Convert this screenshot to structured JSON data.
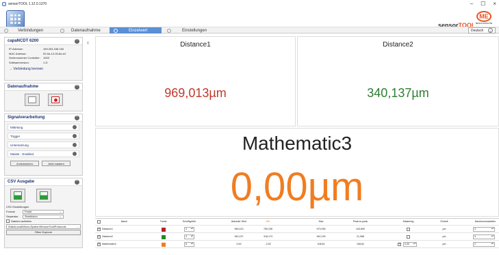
{
  "window": {
    "title": "sensorTOOL 1.12.0.1370",
    "min": "–",
    "max": "☐",
    "close": "×"
  },
  "brand": {
    "prefix": "sensor",
    "accent": "TOOL",
    "me_text": "ME",
    "me_sub": "MICRO-EPSILON"
  },
  "nav": {
    "tabs": [
      "Verbindungen",
      "Datenaufnahme",
      "Einzelwert",
      "Einstellungen"
    ],
    "active_index": 2,
    "language": "Deutsch"
  },
  "sidebar": {
    "device": {
      "title": "capaNCDT 6200",
      "rows": [
        {
          "k": "IP-Adresse:",
          "v": "169.254.168.150"
        },
        {
          "k": "MAC Adresse:",
          "v": "00-0a-12-00-8e-e2"
        },
        {
          "k": "Seriennummer Controller:",
          "v": "1003"
        },
        {
          "k": "Softwareversion:",
          "v": "1.2i"
        }
      ],
      "disconnect": "Verbindung trennen"
    },
    "datenaufnahme": {
      "title": "Datenaufnahme"
    },
    "signal": {
      "title": "Signalverarbeitung",
      "items": [
        "Mittelung",
        "Trigger",
        "Untersetzung",
        "Master : Enabled"
      ],
      "buttons": [
        "Zurücksetzen",
        "Jetzt mastern"
      ]
    },
    "csv": {
      "title": "CSV Ausgabe",
      "settings_label": "CSV Einstellungen",
      "format_label": "Format",
      "format_value": "Punkt",
      "separator_label": "Separator",
      "separator_value": "Semikolon",
      "split_label": "Dateien aufteilen",
      "path": "\\Data\\Local\\Micro-Epsilon\\SensorTool\\Protocols",
      "browse": "...",
      "open": "Öffne Explorer"
    }
  },
  "displays": [
    {
      "title": "Distance1",
      "value": "969,013µm",
      "color": "#c0392b"
    },
    {
      "title": "Distance2",
      "value": "340,137µm",
      "color": "#2e7d32"
    },
    {
      "title": "Mathematic3",
      "value": "0,00µm",
      "color": "#f07d22"
    }
  ],
  "table": {
    "headers": [
      "Name",
      "Farbe",
      "Schriftgröße",
      "Aktueller Wert",
      "Min",
      "Max",
      "Peak-to-peak",
      "Mastering",
      "Einheit",
      "Nachkommastellen"
    ],
    "rows": [
      {
        "name": "Distance1",
        "color": "#b22222",
        "font": "3",
        "current": "969,013",
        "min": "750,236",
        "max": "973,935",
        "p2p": "193,699",
        "mastering": "",
        "unit": "µm",
        "decimals": "3"
      },
      {
        "name": "Distance2",
        "color": "#228b22",
        "font": "3",
        "current": "340,137",
        "min": "318,173",
        "max": "340,139",
        "p2p": "21,968",
        "mastering": "",
        "unit": "µm",
        "decimals": "3"
      },
      {
        "name": "Mathematic3",
        "color": "#f07d22",
        "font": "6",
        "current": "0,00",
        "min": "-2,00",
        "max": "108,81",
        "p2p": "108,81",
        "mastering": "0,00",
        "unit": "µm",
        "decimals": "2"
      }
    ]
  }
}
